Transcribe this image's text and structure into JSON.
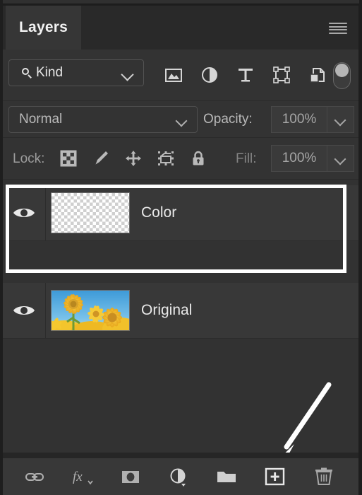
{
  "panel": {
    "tab_label": "Layers",
    "menu_icon": "panel-menu-icon"
  },
  "filter": {
    "kind_label": "Kind",
    "search_icon": "search-icon",
    "caret_icon": "chevron-down-icon",
    "type_filters": [
      {
        "name": "filter-pixel-layers",
        "icon": "image-icon"
      },
      {
        "name": "filter-adjustment-layers",
        "icon": "half-circle-icon"
      },
      {
        "name": "filter-type-layers",
        "icon": "text-t-icon"
      },
      {
        "name": "filter-shape-layers",
        "icon": "shape-bounds-icon"
      },
      {
        "name": "filter-smart-objects",
        "icon": "smart-object-icon"
      }
    ],
    "toggle_name": "filter-enable-toggle"
  },
  "blend": {
    "mode": "Normal",
    "opacity_label": "Opacity:",
    "opacity_value": "100%"
  },
  "lock": {
    "label": "Lock:",
    "items": [
      {
        "name": "lock-transparent-pixels",
        "icon": "checkerboard-icon"
      },
      {
        "name": "lock-image-pixels",
        "icon": "brush-icon"
      },
      {
        "name": "lock-position",
        "icon": "move-arrows-icon"
      },
      {
        "name": "lock-artboard-nesting",
        "icon": "artboard-icon"
      },
      {
        "name": "lock-all",
        "icon": "padlock-icon"
      }
    ],
    "fill_label": "Fill:",
    "fill_value": "100%"
  },
  "layers": [
    {
      "name": "Color",
      "thumb": "transparent-checker",
      "visible": true,
      "selected": true
    },
    {
      "name": "Original",
      "thumb": "sunflowers-photo",
      "visible": true,
      "selected": false
    }
  ],
  "bottom_toolbar": [
    {
      "name": "link-layers-button",
      "icon": "link-icon"
    },
    {
      "name": "layer-style-button",
      "icon": "fx-icon"
    },
    {
      "name": "add-layer-mask-button",
      "icon": "mask-icon"
    },
    {
      "name": "new-adjustment-layer-button",
      "icon": "half-circle-icon"
    },
    {
      "name": "new-group-button",
      "icon": "folder-icon"
    },
    {
      "name": "new-layer-button",
      "icon": "plus-square-icon"
    },
    {
      "name": "delete-layer-button",
      "icon": "trash-icon"
    }
  ],
  "annotation": {
    "arrow_target": "new-layer-button",
    "arrow_color": "#ffffff"
  },
  "colors": {
    "panel_bg": "#323232",
    "row_bg": "#383838",
    "header_bg": "#292929",
    "tab_bg": "#363636",
    "selection": "#ffffff",
    "text": "#e9e9e9",
    "muted_text": "#9c9c9c"
  }
}
